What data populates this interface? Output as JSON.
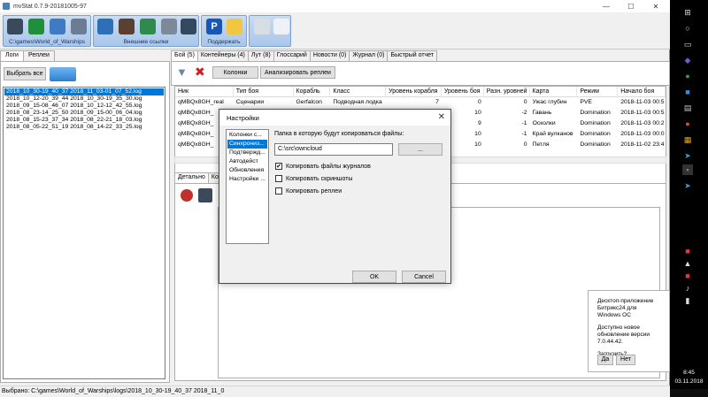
{
  "window": {
    "title": "mvStat 0.7.9-20181005-97"
  },
  "toolbar": {
    "groups": [
      {
        "label": "C:\\games\\World_of_Warships"
      },
      {
        "label": "Внешние ссылки"
      },
      {
        "label": "Поддержать"
      }
    ]
  },
  "left": {
    "tabs": [
      "Логи",
      "Реплеи"
    ],
    "select_all_label": "Выбрать все",
    "logs": [
      "2018_10_30-19_40_37 2018_11_03-01_07_52.log",
      "2018_10_12-20_39_44 2018_10_30-19_35_30.log",
      "2018_09_15-08_46_07 2018_10_12-12_42_55.log",
      "2018_08_23-14_25_50 2018_09_15-00_06_04.log",
      "2018_08_15-23_37_34 2018_08_22-21_18_03.log",
      "2018_08_05-22_51_19 2018_08_14-22_33_25.log"
    ]
  },
  "right": {
    "tabs": [
      "Бой (5)",
      "Контейнеры (4)",
      "Лут (8)",
      "Глоссарий",
      "Новости (0)",
      "Журнал (0)",
      "Быстрый отчет"
    ],
    "columns_button": "Колонки",
    "analyze_button": "Анализировать реплеи",
    "columns": [
      "Ник",
      "Тип боя",
      "Корабль",
      "Класс",
      "Уровень корабля",
      "Уровень боя",
      "Разн. уровней",
      "Карта",
      "Режим",
      "Начало боя"
    ],
    "rows": [
      [
        "qMBQx8GH_real",
        "Сценарии",
        "Gerfalcon",
        "Подводная лодка",
        "7",
        "0",
        "0",
        "Ужас глубин",
        "PVE",
        "2018-11-03 00:5"
      ],
      [
        "qMBQx8GH_",
        "",
        "",
        "",
        "",
        "10",
        "-2",
        "Гавань",
        "Domination",
        "2018-11-03 00:5"
      ],
      [
        "qMBQx8GH_",
        "",
        "",
        "",
        "",
        "9",
        "-1",
        "Осколки",
        "Domination",
        "2018-11-03 00:2"
      ],
      [
        "qMBQx8GH_",
        "",
        "",
        "",
        "",
        "10",
        "-1",
        "Край вулканов",
        "Domination",
        "2018-11-03 00:0"
      ],
      [
        "qMBQx8GH_",
        "",
        "",
        "",
        "",
        "10",
        "0",
        "Петля",
        "Domination",
        "2018-11-02 23:4"
      ]
    ],
    "detail_tabs": [
      "Детально",
      "Ко"
    ]
  },
  "dialog": {
    "title": "Настройки",
    "nav": [
      "Колонки с...",
      "Синхрониз...",
      "Подтвержд...",
      "Автодейст",
      "Обновления",
      "Настройки ..."
    ],
    "folder_label": "Папка в которую будут копироваться файлы:",
    "folder_value": "C:\\src\\owncloud",
    "browse_label": "...",
    "checkboxes": [
      {
        "label": "Копировать файлы журналов",
        "checked": true
      },
      {
        "label": "Копировать скриншоты",
        "checked": false
      },
      {
        "label": "Копировать реплеи",
        "checked": false
      }
    ],
    "ok_label": "OK",
    "cancel_label": "Cancel"
  },
  "status": {
    "text": "Выбрано: C:\\games\\World_of_Warships\\logs\\2018_10_30-19_40_37 2018_11_0"
  },
  "notification": {
    "line1": "Десктоп-приложение Битрикс24 для Windows OC",
    "line2": "Доступно новое обновление версии 7.0.44.42.",
    "line3": "Загрузить?",
    "yes_label": "Да",
    "no_label": "Нет"
  },
  "clock": {
    "time": "8:45",
    "date": "03.11.2018"
  }
}
